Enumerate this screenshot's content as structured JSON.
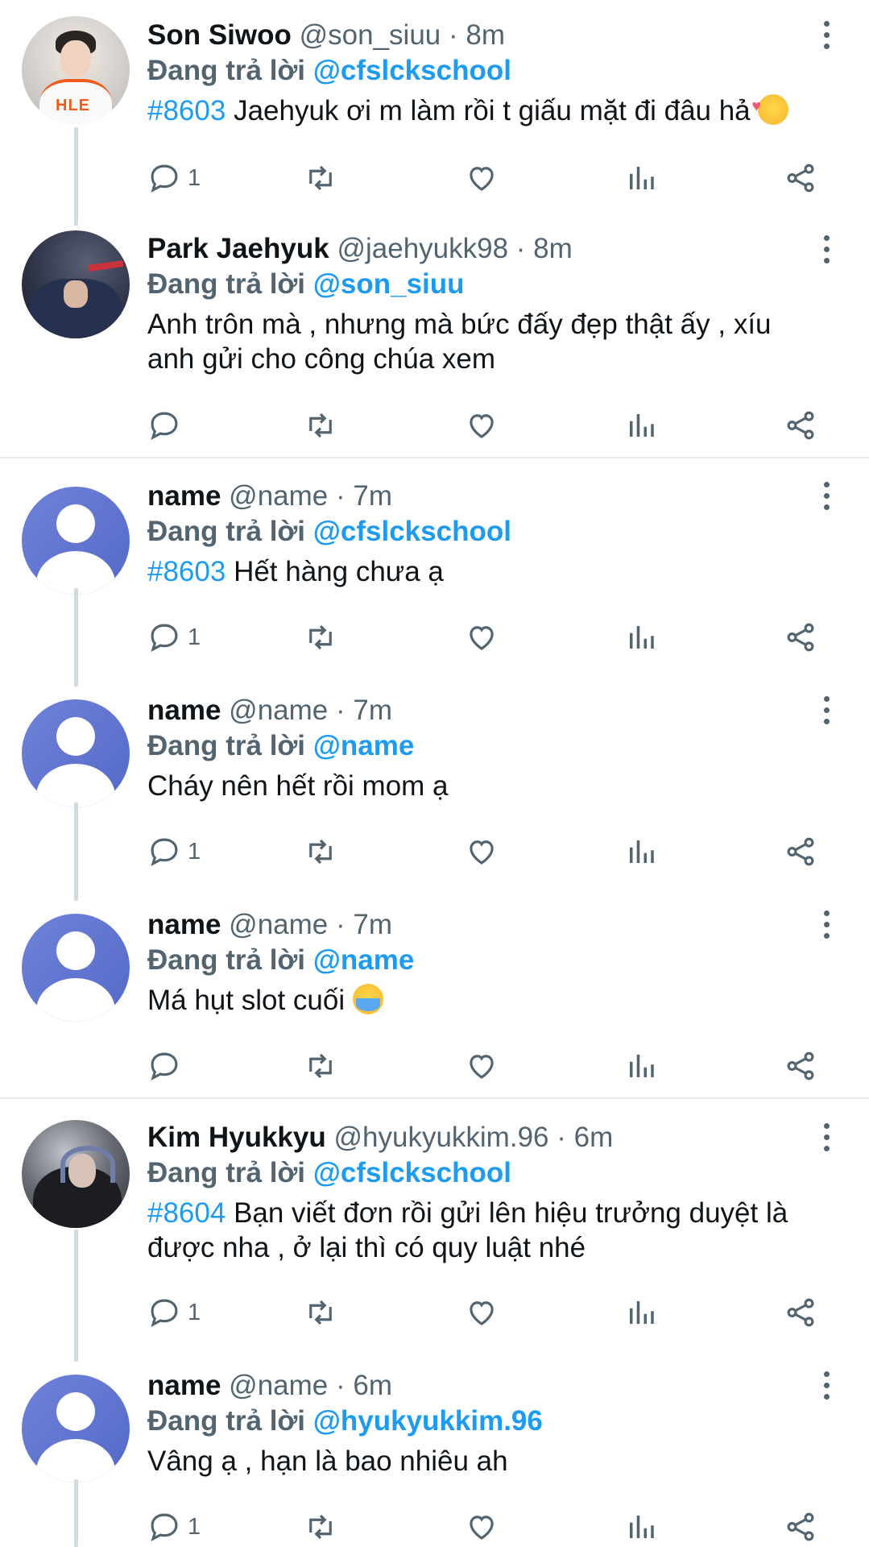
{
  "reply_prefix": "Đang trả lời",
  "tweets": [
    {
      "name": "Son Siwoo",
      "handle": "@son_siuu",
      "time": "· 8m",
      "reply_to": "@cfslckschool",
      "hashtag": "#8603",
      "text": "Jaehyuk ơi m làm rồi t giấu mặt đi đâu hả",
      "emoji": "smiling-face-with-hearts",
      "reply_count": "1"
    },
    {
      "name": "Park Jaehyuk",
      "handle": "@jaehyukk98",
      "time": "· 8m",
      "reply_to": "@son_siuu",
      "hashtag": "",
      "text": "Anh trôn mà , nhưng mà bức đấy đẹp thật ấy , xíu anh gửi cho công chúa xem",
      "reply_count": ""
    },
    {
      "name": "name",
      "handle": "@name",
      "time": "· 7m",
      "reply_to": "@cfslckschool",
      "hashtag": "#8603",
      "text": "Hết hàng chưa ạ",
      "reply_count": "1"
    },
    {
      "name": "name",
      "handle": "@name",
      "time": "· 7m",
      "reply_to": "@name",
      "hashtag": "",
      "text": "Cháy nên hết rồi mom ạ",
      "reply_count": "1"
    },
    {
      "name": "name",
      "handle": "@name",
      "time": "· 7m",
      "reply_to": "@name",
      "hashtag": "",
      "text": "Má hụt slot cuối",
      "emoji": "loudly-crying-face",
      "reply_count": ""
    },
    {
      "name": "Kim Hyukkyu",
      "handle": "@hyukyukkim.96",
      "time": "· 6m",
      "reply_to": "@cfslckschool",
      "hashtag": "#8604",
      "text": "Bạn viết đơn rồi gửi lên hiệu trưởng duyệt là được nha , ở lại thì có quy luật nhé",
      "reply_count": "1"
    },
    {
      "name": "name",
      "handle": "@name",
      "time": "· 6m",
      "reply_to": "@hyukyukkim.96",
      "hashtag": "",
      "text": "Vâng ạ , hạn là bao nhiêu ah",
      "reply_count": "1"
    }
  ],
  "icons": {
    "reply": "reply-icon",
    "retweet": "retweet-icon",
    "like": "heart-icon",
    "views": "analytics-icon",
    "share": "share-icon",
    "more": "more-vertical-icon"
  },
  "colors": {
    "link_blue": "#1d9bf0",
    "secondary_text": "#536471",
    "thread_line": "#cfd9de",
    "default_avatar": "#6f83d9"
  }
}
